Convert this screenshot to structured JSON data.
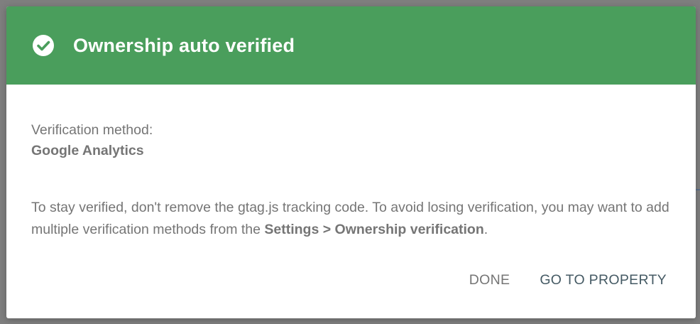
{
  "dialog": {
    "title": "Ownership auto verified",
    "header_color": "#4a9e5c",
    "icon": "check-circle-icon",
    "method_label": "Verification method:",
    "method_value": "Google Analytics",
    "note_text": "To stay verified, don't remove the gtag.js tracking code. To avoid losing verification, you may want to add multiple verification methods from the ",
    "note_link": "Settings > Ownership verification",
    "note_end": ".",
    "actions": {
      "done_label": "DONE",
      "done_color": "#757575",
      "go_label": "GO TO PROPERTY",
      "go_color": "#455a64"
    }
  }
}
